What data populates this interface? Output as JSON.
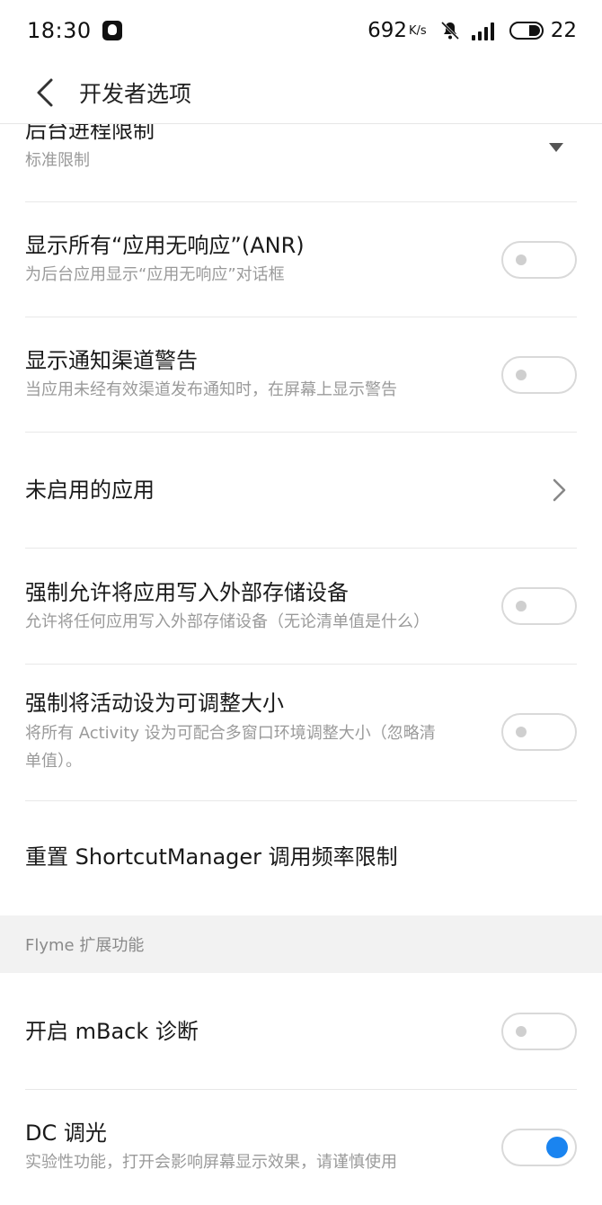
{
  "status_bar": {
    "time": "18:30",
    "net_speed": "692",
    "net_speed_unit": "K/s",
    "battery": "22",
    "icons": [
      "qq-icon",
      "mute-icon",
      "signal-icon",
      "battery-icon"
    ]
  },
  "header": {
    "title": "开发者选项",
    "back_icon": "chevron-left-icon"
  },
  "settings": [
    {
      "title": "后台进程限制",
      "subtitle": "标准限制",
      "control": "dropdown"
    },
    {
      "title": "显示所有“应用无响应”(ANR)",
      "subtitle": "为后台应用显示“应用无响应”对话框",
      "control": "toggle",
      "checked": false
    },
    {
      "title": "显示通知渠道警告",
      "subtitle": "当应用未经有效渠道发布通知时，在屏幕上显示警告",
      "control": "toggle",
      "checked": false
    },
    {
      "title": "未启用的应用",
      "control": "chevron"
    },
    {
      "title": "强制允许将应用写入外部存储设备",
      "subtitle": "允许将任何应用写入外部存储设备（无论清单值是什么）",
      "control": "toggle",
      "checked": false
    },
    {
      "title": "强制将活动设为可调整大小",
      "subtitle_line1": "将所有 Activity 设为可配合多窗口环境调整大小（忽略清",
      "subtitle_line2": "单值）。",
      "control": "toggle",
      "checked": false
    },
    {
      "title": "重置 ShortcutManager 调用频率限制",
      "control": "none"
    }
  ],
  "section": {
    "label": "Flyme 扩展功能"
  },
  "flyme_settings": [
    {
      "title": "开启 mBack 诊断",
      "control": "toggle",
      "checked": false
    },
    {
      "title": "DC 调光",
      "subtitle": "实验性功能，打开会影响屏幕显示效果，请谨慎使用",
      "control": "toggle",
      "checked": true
    }
  ],
  "colors": {
    "accent": "#1a84f0",
    "toggle_border": "#d9d9d9",
    "section_bg": "#f2f2f2",
    "subtitle": "#9a9a9a"
  }
}
